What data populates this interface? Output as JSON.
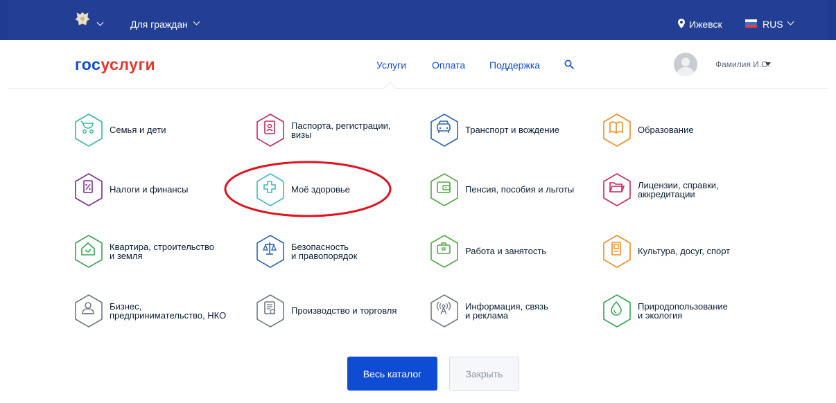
{
  "topbar": {
    "for_citizens": "Для граждан",
    "city": "Ижевск",
    "lang": "RUS"
  },
  "header": {
    "logo_part1": "гос",
    "logo_part2": "услуги",
    "nav": [
      "Услуги",
      "Оплата",
      "Поддержка"
    ],
    "user_name": "Фамилия И.О."
  },
  "categories": [
    {
      "l1": "Семья и дети",
      "l2": "",
      "icon": "stroller-icon",
      "color": "#35b8a5"
    },
    {
      "l1": "Паспорта, регистрации,",
      "l2": "визы",
      "icon": "passport-icon",
      "color": "#c8255d"
    },
    {
      "l1": "Транспорт и вождение",
      "l2": "",
      "icon": "car-icon",
      "color": "#2866b3"
    },
    {
      "l1": "Образование",
      "l2": "",
      "icon": "book-icon",
      "color": "#ee8a1f"
    },
    {
      "l1": "Налоги и финансы",
      "l2": "",
      "icon": "tax-document-icon",
      "color": "#7b2a8e"
    },
    {
      "l1": "Моё здоровье",
      "l2": "",
      "icon": "medical-cross-icon",
      "color": "#3fb7c2"
    },
    {
      "l1": "Пенсия, пособия и льготы",
      "l2": "",
      "icon": "wallet-icon",
      "color": "#4daa3f"
    },
    {
      "l1": "Лицензии, справки,",
      "l2": "аккредитации",
      "icon": "folder-icon",
      "color": "#c8255d"
    },
    {
      "l1": "Квартира, строительство",
      "l2": "и земля",
      "icon": "house-icon",
      "color": "#31a552"
    },
    {
      "l1": "Безопасность",
      "l2": "и правопорядок",
      "icon": "scales-icon",
      "color": "#2866b3"
    },
    {
      "l1": "Работа и занятость",
      "l2": "",
      "icon": "briefcase-icon",
      "color": "#4daa3f"
    },
    {
      "l1": "Культура, досуг, спорт",
      "l2": "",
      "icon": "ticket-icon",
      "color": "#ee8a1f"
    },
    {
      "l1": "Бизнес,",
      "l2": "предпринимательство, НКО",
      "icon": "business-person-icon",
      "color": "#707b86"
    },
    {
      "l1": "Производство и торговля",
      "l2": "",
      "icon": "trade-document-icon",
      "color": "#707b86"
    },
    {
      "l1": "Информация, связь",
      "l2": "и реклама",
      "icon": "antenna-icon",
      "color": "#707b86"
    },
    {
      "l1": "Природопользование",
      "l2": "и экология",
      "icon": "water-drop-icon",
      "color": "#31a552"
    }
  ],
  "buttons": {
    "catalog": "Весь каталог",
    "close": "Закрыть"
  },
  "colors": {
    "topbar": "#233f95",
    "accent": "#0d4cd3",
    "highlight": "#e0121c"
  }
}
